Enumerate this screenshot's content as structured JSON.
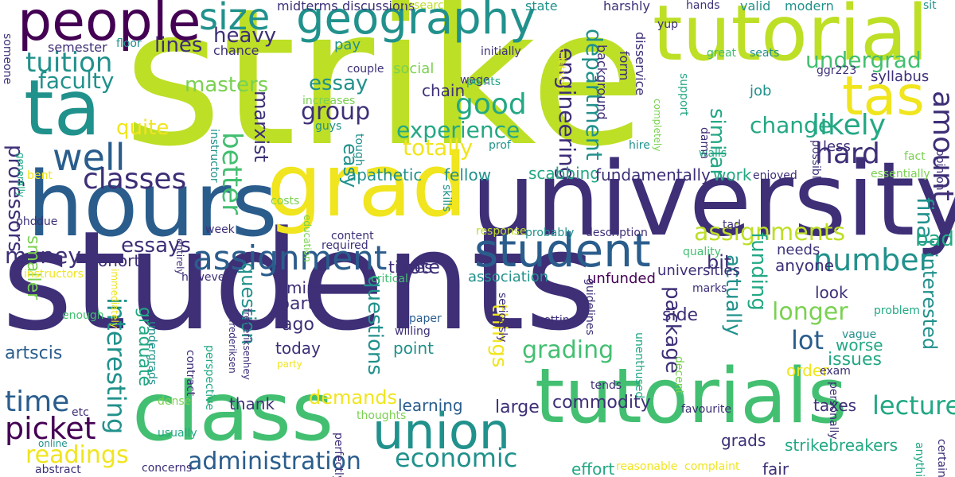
{
  "palette": {
    "purple": "#440154",
    "indigo": "#3e2f77",
    "blue": "#31688e",
    "steel": "#2a5d8c",
    "teal": "#21918c",
    "aqua": "#23a884",
    "green": "#43bf71",
    "lime": "#7ad151",
    "chartreuse": "#bddf26",
    "yellow": "#f0e51e"
  },
  "words": [
    {
      "text": "students",
      "color": "indigo"
    },
    {
      "text": "strike",
      "color": "chartreuse"
    },
    {
      "text": "university",
      "color": "indigo"
    },
    {
      "text": "hours",
      "color": "steel"
    },
    {
      "text": "tutorials",
      "color": "green"
    },
    {
      "text": "class",
      "color": "green"
    },
    {
      "text": "grad",
      "color": "yellow"
    },
    {
      "text": "tutorial",
      "color": "chartreuse"
    },
    {
      "text": "ta",
      "color": "teal"
    },
    {
      "text": "tas",
      "color": "yellow"
    },
    {
      "text": "people",
      "color": "purple"
    },
    {
      "text": "geography",
      "color": "teal"
    },
    {
      "text": "union",
      "color": "teal"
    },
    {
      "text": "student",
      "color": "steel"
    },
    {
      "text": "assignment",
      "color": "steel"
    },
    {
      "text": "well",
      "color": "steel"
    },
    {
      "text": "size",
      "color": "teal"
    },
    {
      "text": "number",
      "color": "teal"
    },
    {
      "text": "amount",
      "color": "indigo"
    },
    {
      "text": "hard",
      "color": "indigo"
    },
    {
      "text": "good",
      "color": "aqua"
    },
    {
      "text": "likely",
      "color": "aqua"
    },
    {
      "text": "classes",
      "color": "indigo"
    },
    {
      "text": "assignments",
      "color": "chartreuse"
    },
    {
      "text": "picket",
      "color": "purple"
    },
    {
      "text": "time",
      "color": "steel"
    },
    {
      "text": "tuition",
      "color": "teal"
    },
    {
      "text": "economic",
      "color": "teal"
    },
    {
      "text": "administration",
      "color": "steel"
    },
    {
      "text": "readings",
      "color": "yellow"
    },
    {
      "text": "lecture",
      "color": "aqua"
    },
    {
      "text": "lot",
      "color": "steel"
    },
    {
      "text": "longer",
      "color": "lime"
    },
    {
      "text": "interesting",
      "color": "teal"
    },
    {
      "text": "grading",
      "color": "green"
    },
    {
      "text": "group",
      "color": "indigo"
    },
    {
      "text": "experience",
      "color": "aqua"
    },
    {
      "text": "better",
      "color": "green"
    },
    {
      "text": "heavy",
      "color": "indigo"
    },
    {
      "text": "faculty",
      "color": "teal"
    },
    {
      "text": "masters",
      "color": "lime"
    },
    {
      "text": "essay",
      "color": "teal"
    },
    {
      "text": "department",
      "color": "teal"
    },
    {
      "text": "engineering",
      "color": "indigo"
    },
    {
      "text": "undergrad",
      "color": "green"
    },
    {
      "text": "change",
      "color": "aqua"
    },
    {
      "text": "similar",
      "color": "aqua"
    },
    {
      "text": "essays",
      "color": "indigo"
    },
    {
      "text": "money",
      "color": "indigo"
    },
    {
      "text": "totally",
      "color": "yellow"
    },
    {
      "text": "quite",
      "color": "yellow"
    },
    {
      "text": "lines",
      "color": "indigo"
    },
    {
      "text": "easy",
      "color": "teal"
    },
    {
      "text": "marxist",
      "color": "indigo"
    },
    {
      "text": "professors",
      "color": "indigo"
    },
    {
      "text": "final",
      "color": "teal"
    },
    {
      "text": "bad",
      "color": "aqua"
    },
    {
      "text": "interested",
      "color": "teal"
    },
    {
      "text": "funding",
      "color": "aqua"
    },
    {
      "text": "actually",
      "color": "teal"
    },
    {
      "text": "package",
      "color": "indigo"
    },
    {
      "text": "things",
      "color": "yellow"
    },
    {
      "text": "questions",
      "color": "teal"
    },
    {
      "text": "question",
      "color": "teal"
    },
    {
      "text": "graduate",
      "color": "aqua"
    },
    {
      "text": "demands",
      "color": "yellow"
    },
    {
      "text": "vote",
      "color": "indigo"
    },
    {
      "text": "ago",
      "color": "indigo"
    },
    {
      "text": "part",
      "color": "indigo"
    },
    {
      "text": "bit",
      "color": "indigo"
    },
    {
      "text": "smaller",
      "color": "lime"
    },
    {
      "text": "artscis",
      "color": "steel"
    },
    {
      "text": "commodity",
      "color": "indigo"
    },
    {
      "text": "issues",
      "color": "aqua"
    },
    {
      "text": "worse",
      "color": "aqua"
    },
    {
      "text": "anyone",
      "color": "indigo"
    },
    {
      "text": "side",
      "color": "indigo"
    },
    {
      "text": "strikebreakers",
      "color": "aqua"
    },
    {
      "text": "taxes",
      "color": "indigo"
    },
    {
      "text": "large",
      "color": "indigo"
    },
    {
      "text": "learning",
      "color": "steel"
    },
    {
      "text": "apathetic",
      "color": "teal"
    },
    {
      "text": "fellow",
      "color": "teal"
    },
    {
      "text": "scabbing",
      "color": "aqua"
    },
    {
      "text": "fundamentally",
      "color": "indigo"
    },
    {
      "text": "chain",
      "color": "indigo"
    },
    {
      "text": "today",
      "color": "indigo"
    },
    {
      "text": "mine",
      "color": "indigo"
    },
    {
      "text": "point",
      "color": "teal"
    },
    {
      "text": "times",
      "color": "indigo"
    },
    {
      "text": "thank",
      "color": "indigo"
    },
    {
      "text": "cohort",
      "color": "indigo"
    },
    {
      "text": "work",
      "color": "aqua"
    },
    {
      "text": "effort",
      "color": "aqua"
    },
    {
      "text": "fair",
      "color": "indigo"
    },
    {
      "text": "order",
      "color": "yellow"
    },
    {
      "text": "grads",
      "color": "indigo"
    },
    {
      "text": "universities",
      "color": "indigo"
    },
    {
      "text": "unfunded",
      "color": "purple"
    },
    {
      "text": "association",
      "color": "teal"
    },
    {
      "text": "look",
      "color": "indigo"
    },
    {
      "text": "needs",
      "color": "indigo"
    },
    {
      "text": "job",
      "color": "teal"
    },
    {
      "text": "less",
      "color": "indigo"
    },
    {
      "text": "syllabus",
      "color": "indigo"
    },
    {
      "text": "social",
      "color": "lime"
    },
    {
      "text": "pay",
      "color": "teal"
    },
    {
      "text": "chance",
      "color": "indigo"
    },
    {
      "text": "semester",
      "color": "indigo"
    },
    {
      "text": "discussions",
      "color": "indigo"
    },
    {
      "text": "midterms",
      "color": "indigo"
    },
    {
      "text": "research",
      "color": "chartreuse"
    },
    {
      "text": "state",
      "color": "teal"
    },
    {
      "text": "harshly",
      "color": "indigo"
    },
    {
      "text": "hands",
      "color": "indigo"
    },
    {
      "text": "valid",
      "color": "teal"
    },
    {
      "text": "modern",
      "color": "teal"
    },
    {
      "text": "sit",
      "color": "teal"
    },
    {
      "text": "floor",
      "color": "teal"
    },
    {
      "text": "couple",
      "color": "indigo"
    },
    {
      "text": "wage",
      "color": "indigo"
    },
    {
      "text": "points",
      "color": "aqua"
    },
    {
      "text": "initially",
      "color": "indigo"
    },
    {
      "text": "increases",
      "color": "lime"
    },
    {
      "text": "guys",
      "color": "teal"
    },
    {
      "text": "prof",
      "color": "teal"
    },
    {
      "text": "hire",
      "color": "teal"
    },
    {
      "text": "walls",
      "color": "aqua"
    },
    {
      "text": "damn",
      "color": "indigo"
    },
    {
      "text": "tough",
      "color": "teal"
    },
    {
      "text": "background",
      "color": "indigo"
    },
    {
      "text": "form",
      "color": "indigo"
    },
    {
      "text": "disservice",
      "color": "indigo"
    },
    {
      "text": "yup",
      "color": "indigo"
    },
    {
      "text": "support",
      "color": "aqua"
    },
    {
      "text": "great",
      "color": "green"
    },
    {
      "text": "seats",
      "color": "teal"
    },
    {
      "text": "ggr223",
      "color": "indigo"
    },
    {
      "text": "enjoyed",
      "color": "indigo"
    },
    {
      "text": "essentially",
      "color": "lime"
    },
    {
      "text": "fact",
      "color": "lime"
    },
    {
      "text": "opinion",
      "color": "indigo"
    },
    {
      "text": "possible",
      "color": "indigo"
    },
    {
      "text": "tad",
      "color": "indigo"
    },
    {
      "text": "quality",
      "color": "green"
    },
    {
      "text": "marks",
      "color": "indigo"
    },
    {
      "text": "problem",
      "color": "aqua"
    },
    {
      "text": "vague",
      "color": "teal"
    },
    {
      "text": "exam",
      "color": "indigo"
    },
    {
      "text": "setting",
      "color": "indigo"
    },
    {
      "text": "paper",
      "color": "steel"
    },
    {
      "text": "willing",
      "color": "indigo"
    },
    {
      "text": "critical",
      "color": "green"
    },
    {
      "text": "response",
      "color": "chartreuse"
    },
    {
      "text": "probably",
      "color": "teal"
    },
    {
      "text": "description",
      "color": "indigo"
    },
    {
      "text": "content",
      "color": "indigo"
    },
    {
      "text": "required",
      "color": "indigo"
    },
    {
      "text": "costs",
      "color": "lime"
    },
    {
      "text": "phd",
      "color": "indigo"
    },
    {
      "text": "due",
      "color": "indigo"
    },
    {
      "text": "bent",
      "color": "yellow"
    },
    {
      "text": "generally",
      "color": "aqua"
    },
    {
      "text": "instructor",
      "color": "teal"
    },
    {
      "text": "instructors",
      "color": "yellow"
    },
    {
      "text": "immediately",
      "color": "yellow"
    },
    {
      "text": "however",
      "color": "indigo"
    },
    {
      "text": "week",
      "color": "indigo"
    },
    {
      "text": "enough",
      "color": "green"
    },
    {
      "text": "thoughts",
      "color": "lime"
    },
    {
      "text": "online",
      "color": "teal"
    },
    {
      "text": "usually",
      "color": "aqua"
    },
    {
      "text": "dense",
      "color": "lime"
    },
    {
      "text": "etc",
      "color": "indigo"
    },
    {
      "text": "abstract",
      "color": "indigo"
    },
    {
      "text": "concerns",
      "color": "indigo"
    },
    {
      "text": "reasonable",
      "color": "yellow"
    },
    {
      "text": "complaint",
      "color": "yellow"
    },
    {
      "text": "favourite",
      "color": "indigo"
    },
    {
      "text": "tends",
      "color": "indigo"
    },
    {
      "text": "decent",
      "color": "lime"
    },
    {
      "text": "party",
      "color": "yellow"
    },
    {
      "text": "someone",
      "color": "indigo"
    },
    {
      "text": "entirely",
      "color": "indigo"
    },
    {
      "text": "education",
      "color": "lime"
    },
    {
      "text": "skills",
      "color": "teal"
    },
    {
      "text": "contract",
      "color": "indigo"
    },
    {
      "text": "perspective",
      "color": "aqua"
    },
    {
      "text": "undergrads",
      "color": "teal"
    },
    {
      "text": "frederiksenhey",
      "color": "indigo"
    },
    {
      "text": "frederiksen",
      "color": "indigo"
    },
    {
      "text": "seriously",
      "color": "indigo"
    },
    {
      "text": "perfectly",
      "color": "indigo"
    },
    {
      "text": "guidelines",
      "color": "indigo"
    },
    {
      "text": "unenthused",
      "color": "aqua"
    },
    {
      "text": "personally",
      "color": "indigo"
    },
    {
      "text": "anything",
      "color": "aqua"
    },
    {
      "text": "certainly",
      "color": "indigo"
    },
    {
      "text": "relatively",
      "color": "yellow"
    },
    {
      "text": "completely",
      "color": "lime"
    }
  ]
}
